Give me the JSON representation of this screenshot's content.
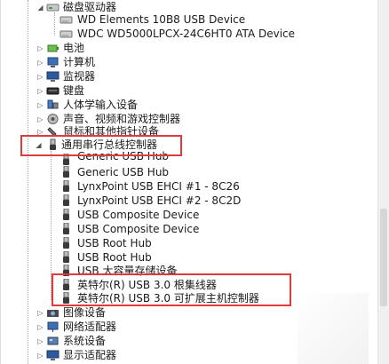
{
  "tree": {
    "disk_drives": {
      "label": "磁盘驱动器",
      "children": [
        "WD Elements 10B8 USB Device",
        "WDC WD5000LPCX-24C6HT0 ATA Device"
      ]
    },
    "battery": "电池",
    "computer": "计算机",
    "monitors": "监视器",
    "keyboards": "键盘",
    "hid": "人体学输入设备",
    "sound": "声音、视频和游戏控制器",
    "mice": "鼠标和其他指针设备",
    "usb_controllers": {
      "label": "通用串行总线控制器",
      "children": [
        "Generic USB Hub",
        "Generic USB Hub",
        "LynxPoint USB EHCI #1 - 8C26",
        "LynxPoint USB EHCI #2 - 8C2D",
        "USB Composite Device",
        "USB Composite Device",
        "USB Root Hub",
        "USB Root Hub",
        "USB 大容量存储设备",
        "英特尔(R) USB 3.0 根集线器",
        "英特尔(R) USB 3.0 可扩展主机控制器"
      ]
    },
    "imaging": "图像设备",
    "network": "网络适配器",
    "system": "系统设备",
    "display": "显示适配器"
  },
  "colors": {
    "highlight": "#e03a3a"
  }
}
